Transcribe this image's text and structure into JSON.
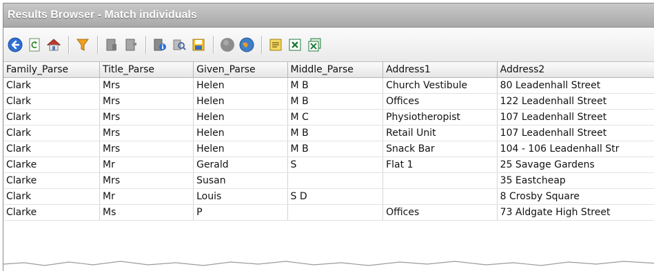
{
  "window": {
    "title": "Results Browser - Match individuals"
  },
  "toolbar": {
    "groups": [
      [
        "back-icon",
        "refresh-icon",
        "home-icon"
      ],
      [
        "filter-icon"
      ],
      [
        "record-icon",
        "record-pane-icon"
      ],
      [
        "record-info-icon",
        "find-records-icon",
        "save-records-icon"
      ],
      [
        "stop-icon",
        "globe-icon"
      ],
      [
        "export-icon",
        "excel-icon",
        "excel-sheets-icon"
      ]
    ]
  },
  "table": {
    "columns": [
      "Family_Parse",
      "Title_Parse",
      "Given_Parse",
      "Middle_Parse",
      "Address1",
      "Address2"
    ],
    "rows": [
      [
        "Clark",
        "Mrs",
        "Helen",
        "M B",
        "Church Vestibule",
        "80 Leadenhall Street"
      ],
      [
        "Clark",
        "Mrs",
        "Helen",
        "M B",
        "Offices",
        "122 Leadenhall Street"
      ],
      [
        "Clark",
        "Mrs",
        "Helen",
        "M C",
        "Physiotheropist",
        "107 Leadenhall Street"
      ],
      [
        "Clark",
        "Mrs",
        "Helen",
        "M B",
        "Retail Unit",
        "107 Leadenhall Street"
      ],
      [
        "Clark",
        "Mrs",
        "Helen",
        "M B",
        "Snack Bar",
        "104 - 106 Leadenhall Str"
      ],
      [
        "Clarke",
        "Mr",
        "Gerald",
        "S",
        "Flat 1",
        "25 Savage Gardens"
      ],
      [
        "Clarke",
        "Mrs",
        "Susan",
        "",
        "",
        "35 Eastcheap"
      ],
      [
        "Clark",
        "Mr",
        "Louis",
        "S D",
        "",
        "8 Crosby Square"
      ],
      [
        "Clarke",
        "Ms",
        "P",
        "",
        "Offices",
        "73 Aldgate High Street"
      ]
    ]
  }
}
